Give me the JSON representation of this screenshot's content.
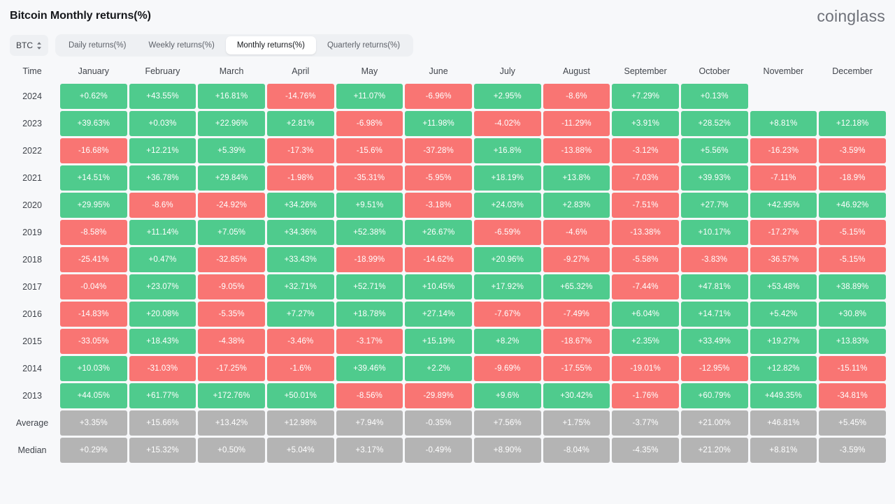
{
  "header": {
    "title": "Bitcoin Monthly returns(%)",
    "brand": "coinglass"
  },
  "controls": {
    "asset": {
      "value": "BTC",
      "icon": "chevron-up-down-icon"
    },
    "tabs": [
      {
        "label": "Daily returns(%)",
        "active": false
      },
      {
        "label": "Weekly returns(%)",
        "active": false
      },
      {
        "label": "Monthly returns(%)",
        "active": true
      },
      {
        "label": "Quarterly returns(%)",
        "active": false
      }
    ]
  },
  "colors": {
    "positive": "#4fcb8d",
    "negative": "#f97573",
    "stat": "#b4b4b4",
    "background": "#f7f8fa",
    "tab_active_bg": "#ffffff",
    "tabbar_bg": "#eef0f3"
  },
  "chart_data": {
    "type": "heatmap",
    "title": "Bitcoin Monthly returns(%)",
    "xlabel": "",
    "ylabel": "Time",
    "legend_position": "none",
    "grid": true,
    "columns": [
      "Time",
      "January",
      "February",
      "March",
      "April",
      "May",
      "June",
      "July",
      "August",
      "September",
      "October",
      "November",
      "December"
    ],
    "categories": [
      "January",
      "February",
      "March",
      "April",
      "May",
      "June",
      "July",
      "August",
      "September",
      "October",
      "November",
      "December"
    ],
    "rows": [
      {
        "label": "2024",
        "kind": "year",
        "values": [
          "+0.62%",
          "+43.55%",
          "+16.81%",
          "-14.76%",
          "+11.07%",
          "-6.96%",
          "+2.95%",
          "-8.6%",
          "+7.29%",
          "+0.13%",
          "",
          ""
        ],
        "numeric": [
          0.62,
          43.55,
          16.81,
          -14.76,
          11.07,
          -6.96,
          2.95,
          -8.6,
          7.29,
          0.13,
          null,
          null
        ]
      },
      {
        "label": "2023",
        "kind": "year",
        "values": [
          "+39.63%",
          "+0.03%",
          "+22.96%",
          "+2.81%",
          "-6.98%",
          "+11.98%",
          "-4.02%",
          "-11.29%",
          "+3.91%",
          "+28.52%",
          "+8.81%",
          "+12.18%"
        ],
        "numeric": [
          39.63,
          0.03,
          22.96,
          2.81,
          -6.98,
          11.98,
          -4.02,
          -11.29,
          3.91,
          28.52,
          8.81,
          12.18
        ]
      },
      {
        "label": "2022",
        "kind": "year",
        "values": [
          "-16.68%",
          "+12.21%",
          "+5.39%",
          "-17.3%",
          "-15.6%",
          "-37.28%",
          "+16.8%",
          "-13.88%",
          "-3.12%",
          "+5.56%",
          "-16.23%",
          "-3.59%"
        ],
        "numeric": [
          -16.68,
          12.21,
          5.39,
          -17.3,
          -15.6,
          -37.28,
          16.8,
          -13.88,
          -3.12,
          5.56,
          -16.23,
          -3.59
        ]
      },
      {
        "label": "2021",
        "kind": "year",
        "values": [
          "+14.51%",
          "+36.78%",
          "+29.84%",
          "-1.98%",
          "-35.31%",
          "-5.95%",
          "+18.19%",
          "+13.8%",
          "-7.03%",
          "+39.93%",
          "-7.11%",
          "-18.9%"
        ],
        "numeric": [
          14.51,
          36.78,
          29.84,
          -1.98,
          -35.31,
          -5.95,
          18.19,
          13.8,
          -7.03,
          39.93,
          -7.11,
          -18.9
        ]
      },
      {
        "label": "2020",
        "kind": "year",
        "values": [
          "+29.95%",
          "-8.6%",
          "-24.92%",
          "+34.26%",
          "+9.51%",
          "-3.18%",
          "+24.03%",
          "+2.83%",
          "-7.51%",
          "+27.7%",
          "+42.95%",
          "+46.92%"
        ],
        "numeric": [
          29.95,
          -8.6,
          -24.92,
          34.26,
          9.51,
          -3.18,
          24.03,
          2.83,
          -7.51,
          27.7,
          42.95,
          46.92
        ]
      },
      {
        "label": "2019",
        "kind": "year",
        "values": [
          "-8.58%",
          "+11.14%",
          "+7.05%",
          "+34.36%",
          "+52.38%",
          "+26.67%",
          "-6.59%",
          "-4.6%",
          "-13.38%",
          "+10.17%",
          "-17.27%",
          "-5.15%"
        ],
        "numeric": [
          -8.58,
          11.14,
          7.05,
          34.36,
          52.38,
          26.67,
          -6.59,
          -4.6,
          -13.38,
          10.17,
          -17.27,
          -5.15
        ]
      },
      {
        "label": "2018",
        "kind": "year",
        "values": [
          "-25.41%",
          "+0.47%",
          "-32.85%",
          "+33.43%",
          "-18.99%",
          "-14.62%",
          "+20.96%",
          "-9.27%",
          "-5.58%",
          "-3.83%",
          "-36.57%",
          "-5.15%"
        ],
        "numeric": [
          -25.41,
          0.47,
          -32.85,
          33.43,
          -18.99,
          -14.62,
          20.96,
          -9.27,
          -5.58,
          -3.83,
          -36.57,
          -5.15
        ]
      },
      {
        "label": "2017",
        "kind": "year",
        "values": [
          "-0.04%",
          "+23.07%",
          "-9.05%",
          "+32.71%",
          "+52.71%",
          "+10.45%",
          "+17.92%",
          "+65.32%",
          "-7.44%",
          "+47.81%",
          "+53.48%",
          "+38.89%"
        ],
        "numeric": [
          -0.04,
          23.07,
          -9.05,
          32.71,
          52.71,
          10.45,
          17.92,
          65.32,
          -7.44,
          47.81,
          53.48,
          38.89
        ]
      },
      {
        "label": "2016",
        "kind": "year",
        "values": [
          "-14.83%",
          "+20.08%",
          "-5.35%",
          "+7.27%",
          "+18.78%",
          "+27.14%",
          "-7.67%",
          "-7.49%",
          "+6.04%",
          "+14.71%",
          "+5.42%",
          "+30.8%"
        ],
        "numeric": [
          -14.83,
          20.08,
          -5.35,
          7.27,
          18.78,
          27.14,
          -7.67,
          -7.49,
          6.04,
          14.71,
          5.42,
          30.8
        ]
      },
      {
        "label": "2015",
        "kind": "year",
        "values": [
          "-33.05%",
          "+18.43%",
          "-4.38%",
          "-3.46%",
          "-3.17%",
          "+15.19%",
          "+8.2%",
          "-18.67%",
          "+2.35%",
          "+33.49%",
          "+19.27%",
          "+13.83%"
        ],
        "numeric": [
          -33.05,
          18.43,
          -4.38,
          -3.46,
          -3.17,
          15.19,
          8.2,
          -18.67,
          2.35,
          33.49,
          19.27,
          13.83
        ]
      },
      {
        "label": "2014",
        "kind": "year",
        "values": [
          "+10.03%",
          "-31.03%",
          "-17.25%",
          "-1.6%",
          "+39.46%",
          "+2.2%",
          "-9.69%",
          "-17.55%",
          "-19.01%",
          "-12.95%",
          "+12.82%",
          "-15.11%"
        ],
        "numeric": [
          10.03,
          -31.03,
          -17.25,
          -1.6,
          39.46,
          2.2,
          -9.69,
          -17.55,
          -19.01,
          -12.95,
          12.82,
          -15.11
        ]
      },
      {
        "label": "2013",
        "kind": "year",
        "values": [
          "+44.05%",
          "+61.77%",
          "+172.76%",
          "+50.01%",
          "-8.56%",
          "-29.89%",
          "+9.6%",
          "+30.42%",
          "-1.76%",
          "+60.79%",
          "+449.35%",
          "-34.81%"
        ],
        "numeric": [
          44.05,
          61.77,
          172.76,
          50.01,
          -8.56,
          -29.89,
          9.6,
          30.42,
          -1.76,
          60.79,
          449.35,
          -34.81
        ]
      },
      {
        "label": "Average",
        "kind": "stat",
        "values": [
          "+3.35%",
          "+15.66%",
          "+13.42%",
          "+12.98%",
          "+7.94%",
          "-0.35%",
          "+7.56%",
          "+1.75%",
          "-3.77%",
          "+21.00%",
          "+46.81%",
          "+5.45%"
        ],
        "numeric": [
          3.35,
          15.66,
          13.42,
          12.98,
          7.94,
          -0.35,
          7.56,
          1.75,
          -3.77,
          21.0,
          46.81,
          5.45
        ]
      },
      {
        "label": "Median",
        "kind": "stat",
        "values": [
          "+0.29%",
          "+15.32%",
          "+0.50%",
          "+5.04%",
          "+3.17%",
          "-0.49%",
          "+8.90%",
          "-8.04%",
          "-4.35%",
          "+21.20%",
          "+8.81%",
          "-3.59%"
        ],
        "numeric": [
          0.29,
          15.32,
          0.5,
          5.04,
          3.17,
          -0.49,
          8.9,
          -8.04,
          -4.35,
          21.2,
          8.81,
          -3.59
        ]
      }
    ]
  }
}
